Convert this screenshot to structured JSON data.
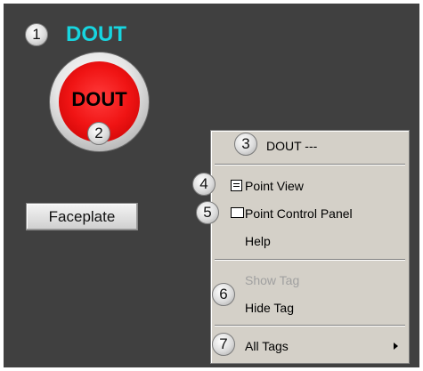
{
  "tag": {
    "name": "DOUT"
  },
  "indicator": {
    "label": "DOUT"
  },
  "faceplate": {
    "label": "Faceplate"
  },
  "callouts": [
    "1",
    "2",
    "3",
    "4",
    "5",
    "6",
    "7"
  ],
  "menu": {
    "header": "DOUT ---",
    "items": {
      "point_view": "Point View",
      "point_control_panel": "Point Control Panel",
      "help": "Help",
      "show_tag": "Show Tag",
      "hide_tag": "Hide Tag",
      "all_tags": "All Tags"
    }
  },
  "colors": {
    "background": "#404040",
    "tag_name": "#17d6e0",
    "indicator_red": "#f01414",
    "menu_bg": "#d4d0c8",
    "disabled_text": "#a0a0a0"
  },
  "icons": {
    "point_view": "list-window-icon",
    "point_control_panel": "panel-window-icon",
    "all_tags": "chevron-right-icon"
  }
}
